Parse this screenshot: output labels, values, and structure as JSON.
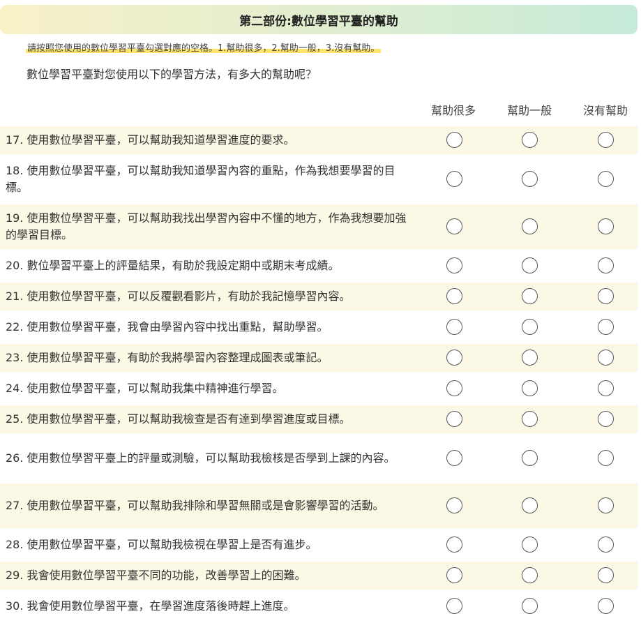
{
  "section_title": "第二部份:數位學習平臺的幫助",
  "instruction": "請按照您使用的數位學習平臺勾選對應的空格。1.幫助很多，2.幫助一般，3.沒有幫助。",
  "question": "數位學習平臺對您使用以下的學習方法，有多大的幫助呢？",
  "columns": [
    "幫助很多",
    "幫助一般",
    "沒有幫助"
  ],
  "items": [
    "17. 使用數位學習平臺，可以幫助我知道學習進度的要求。",
    "18. 使用數位學習平臺，可以幫助我知道學習內容的重點，作為我想要學習的目標。",
    "19. 使用數位學習平臺，可以幫助我找出學習內容中不懂的地方，作為我想要加強的學習目標。",
    "20. 數位學習平臺上的評量結果，有助於我設定期中或期末考成績。",
    "21. 使用數位學習平臺，可以反覆觀看影片，有助於我記憶學習內容。",
    "22. 使用數位學習平臺，我會由學習內容中找出重點，幫助學習。",
    "23. 使用數位學習平臺，有助於我將學習內容整理成圖表或筆記。",
    "24. 使用數位學習平臺，可以幫助我集中精神進行學習。",
    "25. 使用數位學習平臺，可以幫助我檢查是否有達到學習進度或目標。",
    "26. 使用數位學習平臺上的評量或測驗，可以幫助我檢核是否學到上課的內容。",
    "27. 使用數位學習平臺，可以幫助我排除和學習無關或是會影響學習的活動。",
    "28. 使用數位學習平臺，可以幫助我檢視在學習上是否有進步。",
    "29. 我會使用數位學習平臺不同的功能，改善學習上的困難。",
    "30. 我會使用數位學習平臺，在學習進度落後時趕上進度。"
  ]
}
